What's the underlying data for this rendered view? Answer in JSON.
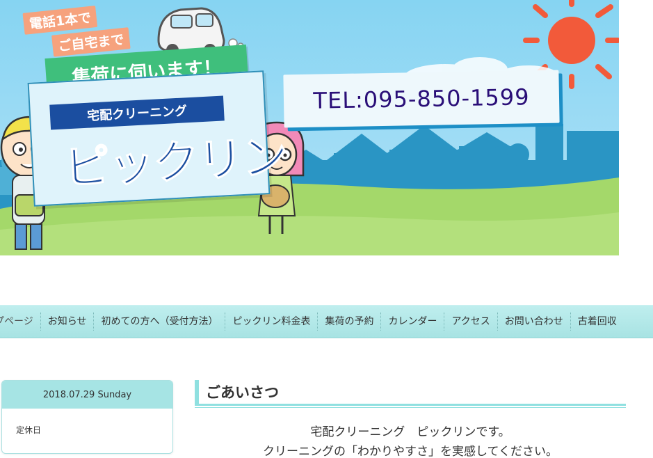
{
  "hero": {
    "tag_line1": "電話1本で",
    "tag_line2": "ご自宅まで",
    "pickup_banner": "集荷に伺います！",
    "logo_ribbon": "宅配クリーニング",
    "logo_name": "ピックリン",
    "tel": "TEL:095-850-1599"
  },
  "nav": {
    "items": [
      "プページ",
      "お知らせ",
      "初めての方へ（受付方法）",
      "ピックリン料金表",
      "集荷の予約",
      "カレンダー",
      "アクセス",
      "お問い合わせ",
      "古着回収"
    ]
  },
  "sidebar": {
    "date": "2018.07.29 Sunday",
    "note": "定休日"
  },
  "main": {
    "title": "ごあいさつ",
    "line1": "宅配クリーニング　ピックリンです。",
    "line2": "クリーニングの「わかりやすさ」を実感してください。"
  },
  "colors": {
    "sky": "#9fdcf5",
    "grass": "#a4d86a",
    "nav_bg": "#b3e9e9",
    "accent_teal": "#8fe0e0",
    "logo_blue": "#1b4ea0",
    "tel_text": "#2a0f78",
    "banner_green": "#3fbf7c",
    "tag_orange": "#f6a27d",
    "sun": "#f25a3a"
  }
}
